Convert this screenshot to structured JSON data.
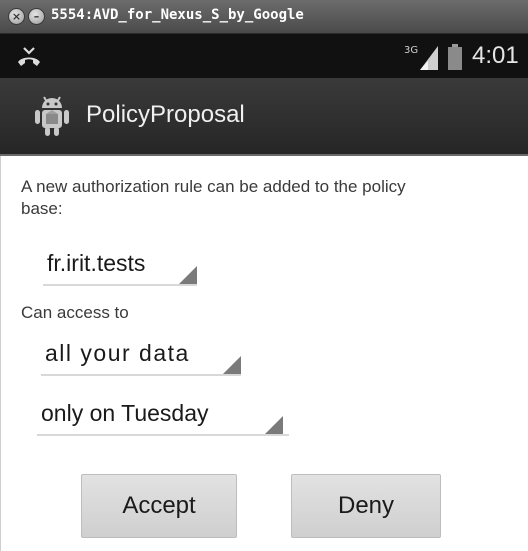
{
  "window": {
    "title": "5554:AVD_for_Nexus_S_by_Google",
    "close_glyph": "×",
    "minimize_glyph": "–"
  },
  "status_bar": {
    "network_label": "3G",
    "time": "4:01",
    "icons": [
      "missed-call-icon",
      "signal-icon",
      "battery-icon"
    ]
  },
  "app_bar": {
    "title": "PolicyProposal",
    "icon": "android-robot-icon"
  },
  "content": {
    "intro": "A new authorization rule can be added to the policy base:",
    "application_spinner": {
      "selected": "fr.irit.tests"
    },
    "can_access_label": "Can access to",
    "data_spinner": {
      "selected": "all your data"
    },
    "time_spinner": {
      "selected": "only on Tuesday"
    }
  },
  "buttons": {
    "accept": "Accept",
    "deny": "Deny"
  },
  "colors": {
    "status_bar": "#111111",
    "app_bar": "#2e2e2e",
    "button": "#d9d9d9",
    "text": "#1a1a1a"
  }
}
